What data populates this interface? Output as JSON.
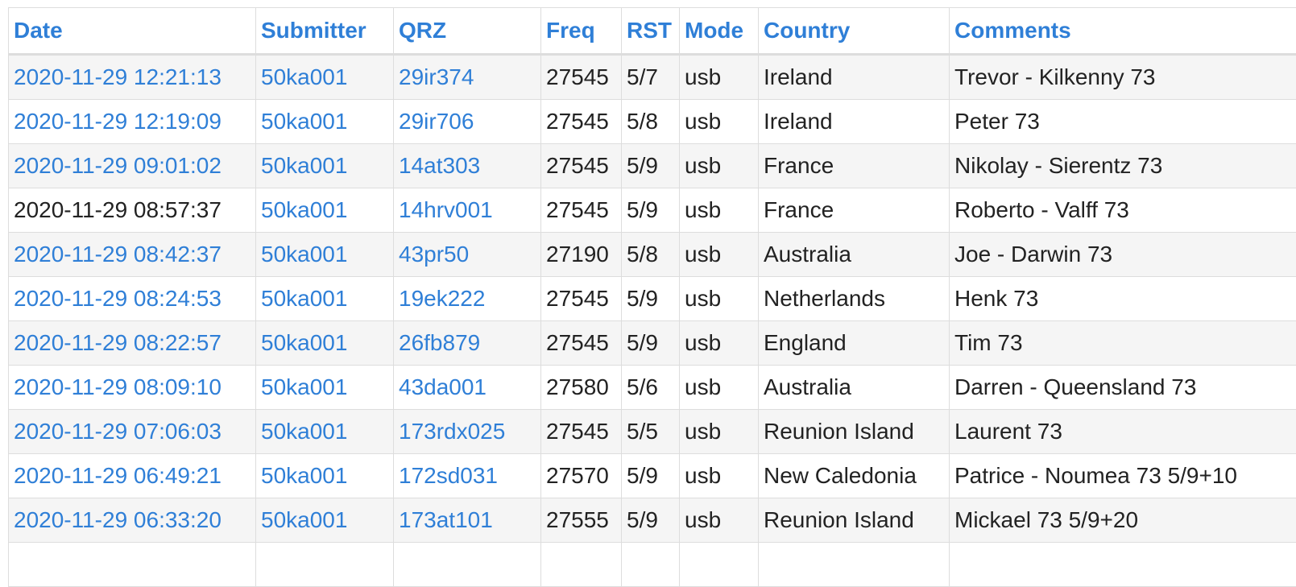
{
  "columns": [
    "Date",
    "Submitter",
    "QRZ",
    "Freq",
    "RST",
    "Mode",
    "Country",
    "Comments"
  ],
  "rows": [
    {
      "date": "2020-11-29 12:21:13",
      "date_link": true,
      "submitter": "50ka001",
      "qrz": "29ir374",
      "freq": "27545",
      "rst": "5/7",
      "mode": "usb",
      "country": "Ireland",
      "comments": "Trevor - Kilkenny 73"
    },
    {
      "date": "2020-11-29 12:19:09",
      "date_link": true,
      "submitter": "50ka001",
      "qrz": "29ir706",
      "freq": "27545",
      "rst": "5/8",
      "mode": "usb",
      "country": "Ireland",
      "comments": "Peter 73"
    },
    {
      "date": "2020-11-29 09:01:02",
      "date_link": true,
      "submitter": "50ka001",
      "qrz": "14at303",
      "freq": "27545",
      "rst": "5/9",
      "mode": "usb",
      "country": "France",
      "comments": "Nikolay - Sierentz 73"
    },
    {
      "date": "2020-11-29 08:57:37",
      "date_link": false,
      "submitter": "50ka001",
      "qrz": "14hrv001",
      "freq": "27545",
      "rst": "5/9",
      "mode": "usb",
      "country": "France",
      "comments": "Roberto - Valff 73"
    },
    {
      "date": "2020-11-29 08:42:37",
      "date_link": true,
      "submitter": "50ka001",
      "qrz": "43pr50",
      "freq": "27190",
      "rst": "5/8",
      "mode": "usb",
      "country": "Australia",
      "comments": "Joe - Darwin 73"
    },
    {
      "date": "2020-11-29 08:24:53",
      "date_link": true,
      "submitter": "50ka001",
      "qrz": "19ek222",
      "freq": "27545",
      "rst": "5/9",
      "mode": "usb",
      "country": "Netherlands",
      "comments": "Henk 73"
    },
    {
      "date": "2020-11-29 08:22:57",
      "date_link": true,
      "submitter": "50ka001",
      "qrz": "26fb879",
      "freq": "27545",
      "rst": "5/9",
      "mode": "usb",
      "country": "England",
      "comments": "Tim 73"
    },
    {
      "date": "2020-11-29 08:09:10",
      "date_link": true,
      "submitter": "50ka001",
      "qrz": "43da001",
      "freq": "27580",
      "rst": "5/6",
      "mode": "usb",
      "country": "Australia",
      "comments": "Darren - Queensland 73"
    },
    {
      "date": "2020-11-29 07:06:03",
      "date_link": true,
      "submitter": "50ka001",
      "qrz": "173rdx025",
      "freq": "27545",
      "rst": "5/5",
      "mode": "usb",
      "country": "Reunion Island",
      "comments": "Laurent 73"
    },
    {
      "date": "2020-11-29 06:49:21",
      "date_link": true,
      "submitter": "50ka001",
      "qrz": "172sd031",
      "freq": "27570",
      "rst": "5/9",
      "mode": "usb",
      "country": "New Caledonia",
      "comments": "Patrice - Noumea 73 5/9+10"
    },
    {
      "date": "2020-11-29 06:33:20",
      "date_link": true,
      "submitter": "50ka001",
      "qrz": "173at101",
      "freq": "27555",
      "rst": "5/9",
      "mode": "usb",
      "country": "Reunion Island",
      "comments": "Mickael 73 5/9+20"
    },
    {
      "date": "",
      "date_link": false,
      "submitter": "",
      "qrz": "",
      "freq": "",
      "rst": "",
      "mode": "",
      "country": "",
      "comments": ""
    }
  ],
  "colors": {
    "link": "#2f7fd7",
    "text": "#222222",
    "stripe": "#f5f5f5",
    "border": "#dddddd"
  }
}
